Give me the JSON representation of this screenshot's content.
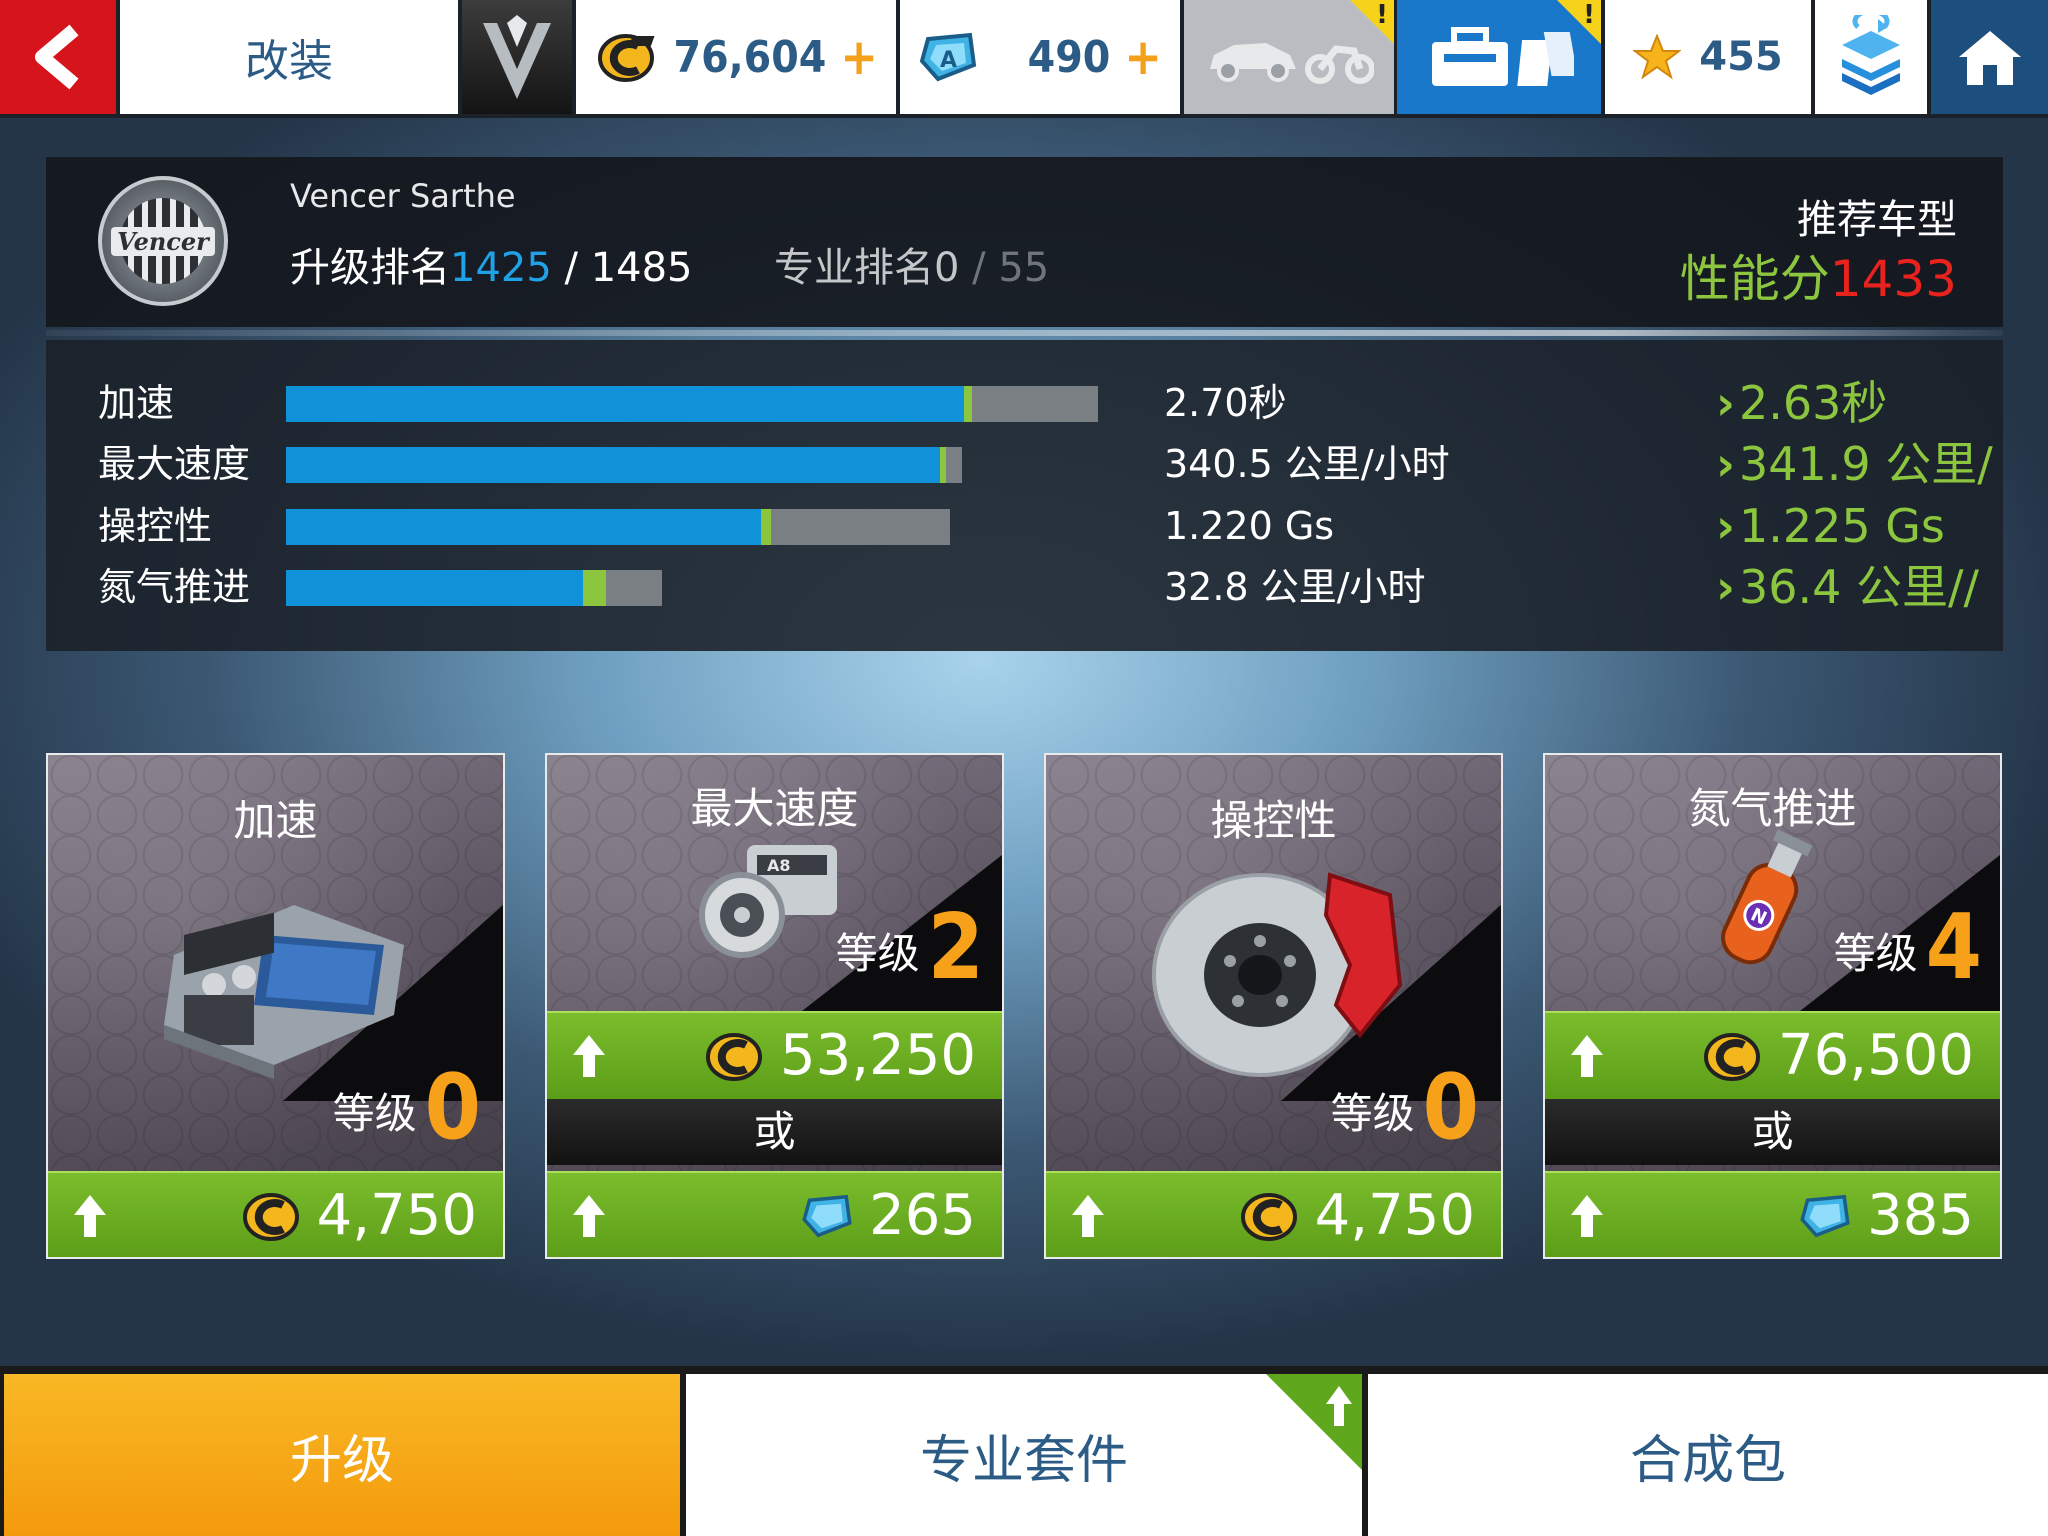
{
  "topbar": {
    "title": "改装",
    "credits": "76,604",
    "credits_plus": "+",
    "tokens": "490",
    "tokens_plus": "+",
    "stars": "455",
    "warn_mark": "!"
  },
  "car": {
    "brand_badge": "Vencer",
    "name": "Vencer Sarthe",
    "upgrade_rank_label": "升级排名",
    "upgrade_rank": "1425",
    "upgrade_rank_max": "/ 1485",
    "pro_rank_label": "专业排名",
    "pro_rank": "0",
    "pro_rank_max": "/ 55",
    "recommended_label": "推荐车型",
    "perf_label": "性能分",
    "perf_value": "1433"
  },
  "stats": [
    {
      "label": "加速",
      "value": "2.70秒",
      "next": "2.63秒",
      "bar_current": 0.835,
      "bar_next": 0.845
    },
    {
      "label": "最大速度",
      "value": "340.5 公里/小时",
      "next": "341.9 公里/",
      "bar_current": 0.968,
      "bar_next": 0.972
    },
    {
      "label": "操控性",
      "value": "1.220 Gs",
      "next": "1.225 Gs",
      "bar_current": 0.715,
      "bar_next": 0.73
    },
    {
      "label": "氮气推进",
      "value": "32.8 公里/小时",
      "next": "36.4 公里/∕",
      "bar_current": 0.79,
      "bar_next": 0.85
    }
  ],
  "cards": [
    {
      "title": "加速",
      "level_label": "等级",
      "level": "0",
      "credit_price": "4,750",
      "or": "",
      "token_price": ""
    },
    {
      "title": "最大速度",
      "level_label": "等级",
      "level": "2",
      "credit_price": "53,250",
      "or": "或",
      "token_price": "265"
    },
    {
      "title": "操控性",
      "level_label": "等级",
      "level": "0",
      "credit_price": "4,750",
      "or": "",
      "token_price": ""
    },
    {
      "title": "氮气推进",
      "level_label": "等级",
      "level": "4",
      "credit_price": "76,500",
      "or": "或",
      "token_price": "385"
    }
  ],
  "tabs": {
    "upgrade": "升级",
    "pro_kits": "专业套件",
    "packs": "合成包"
  },
  "icons": [
    "back-arrow-icon",
    "brand-logo-icon",
    "credits-icon",
    "token-icon",
    "garage-icon",
    "shop-icon",
    "star-icon",
    "sync-icon",
    "home-icon",
    "engine-icon",
    "turbo-icon",
    "brake-icon",
    "nitro-bottle-icon",
    "upgrade-arrow-icon"
  ],
  "colors": {
    "accent_blue": "#0f92d8",
    "upgrade_green": "#8cc63f",
    "level_orange": "#f7a11a",
    "perf_red": "#e8221d",
    "back_red": "#d6141c",
    "active_tab": "#f9b825"
  }
}
